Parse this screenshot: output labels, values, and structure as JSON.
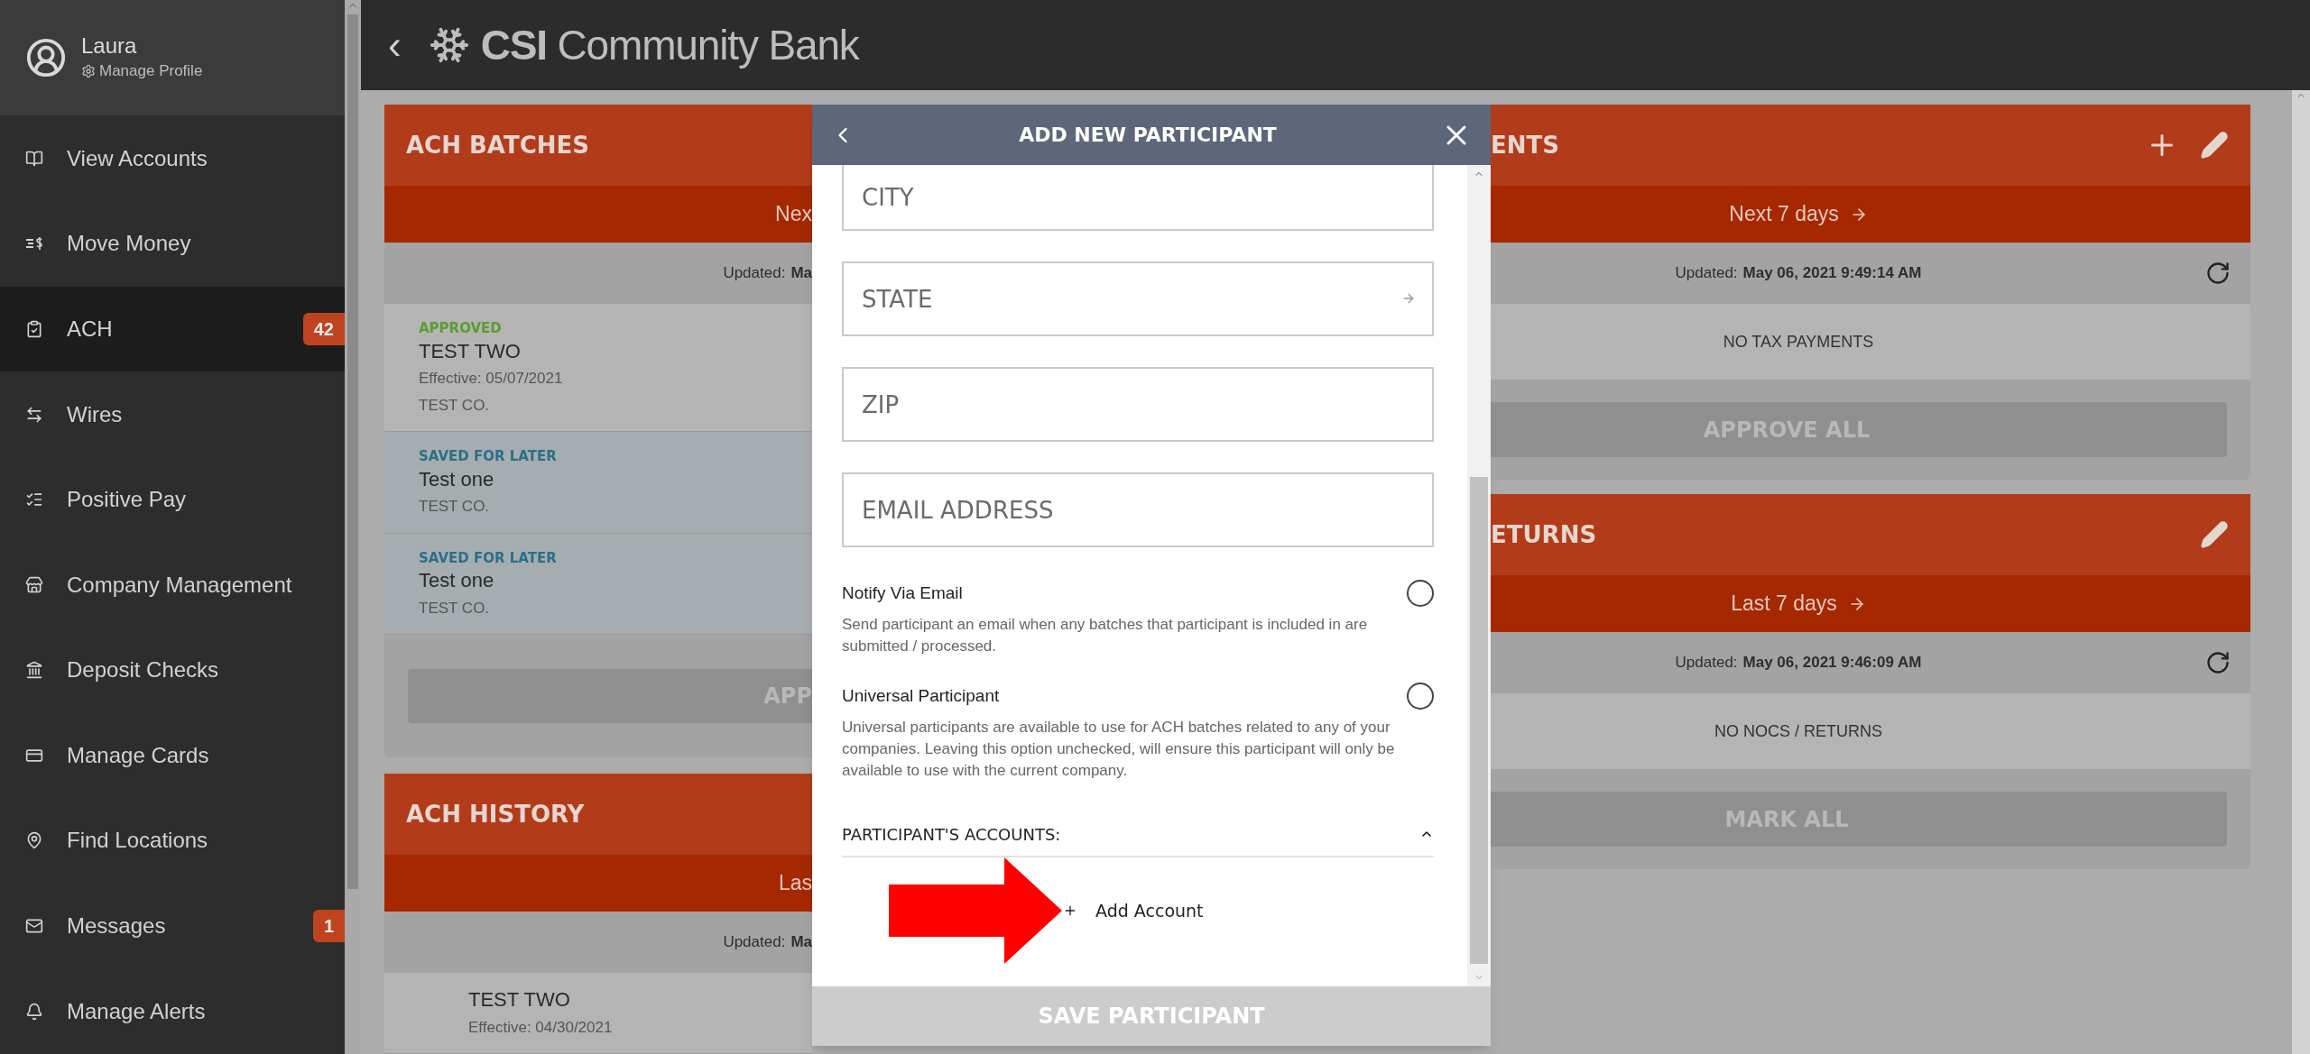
{
  "sidebar": {
    "user": {
      "name": "Laura",
      "link": "Manage Profile"
    },
    "items": [
      {
        "label": "View Accounts",
        "selected": false
      },
      {
        "label": "Move Money",
        "selected": false
      },
      {
        "label": "ACH",
        "selected": true,
        "badge": "42"
      },
      {
        "label": "Wires",
        "selected": false
      },
      {
        "label": "Positive Pay",
        "selected": false
      },
      {
        "label": "Company Management",
        "selected": false
      },
      {
        "label": "Deposit Checks",
        "selected": false
      },
      {
        "label": "Manage Cards",
        "selected": false
      },
      {
        "label": "Find Locations",
        "selected": false
      },
      {
        "label": "Messages",
        "selected": false,
        "badge": "1"
      },
      {
        "label": "Manage Alerts",
        "selected": false
      }
    ]
  },
  "header": {
    "back": "‹",
    "brand_bold": "CSI",
    "brand_rest": "Community Bank"
  },
  "left_panels": [
    {
      "title": "ACH BATCHES",
      "period": "Nex",
      "updated_label": "Updated:",
      "updated_value": "Ma",
      "items": [
        {
          "kind": "approved",
          "status": "APPROVED",
          "name": "TEST TWO",
          "effective": "Effective: 05/07/2021",
          "company": "TEST CO."
        },
        {
          "kind": "saved",
          "status": "SAVED FOR LATER",
          "name": "Test one",
          "company": "TEST CO."
        },
        {
          "kind": "saved",
          "status": "SAVED FOR LATER",
          "name": "Test one",
          "company": "TEST CO."
        }
      ],
      "button": "APP"
    },
    {
      "title": "ACH HISTORY",
      "period": "Las",
      "updated_label": "Updated:",
      "updated_value": "Ma",
      "items": [
        {
          "kind": "history",
          "name": "TEST TWO",
          "effective": "Effective: 04/30/2021"
        }
      ]
    }
  ],
  "right_panels": [
    {
      "title": "ENTS",
      "add": true,
      "period": "Next 7 days",
      "updated_label": "Updated:",
      "updated_value": "May 06, 2021 9:49:14 AM",
      "empty": "NO TAX PAYMENTS",
      "button": "APPROVE ALL"
    },
    {
      "title": "ETURNS",
      "add": false,
      "period": "Last 7 days",
      "updated_label": "Updated:",
      "updated_value": "May 06, 2021 9:46:09 AM",
      "empty": "NO NOCS / RETURNS",
      "button": "MARK ALL"
    }
  ],
  "modal": {
    "title": "ADD NEW PARTICIPANT",
    "fields": [
      {
        "kind": "text",
        "placeholder": "CITY"
      },
      {
        "kind": "select",
        "placeholder": "STATE"
      },
      {
        "kind": "text",
        "placeholder": "ZIP"
      },
      {
        "kind": "text",
        "placeholder": "EMAIL ADDRESS"
      }
    ],
    "options": [
      {
        "label": "Notify Via Email",
        "description": "Send participant an email when any batches that participant is included in are submitted / processed.",
        "checked": false
      },
      {
        "label": "Universal Participant",
        "description": "Universal participants are available to use for ACH batches related to any of your companies. Leaving this option unchecked, will ensure this participant will only be available to use with the current company.",
        "checked": false
      }
    ],
    "section": {
      "title": "PARTICIPANT'S ACCOUNTS:",
      "expanded": true
    },
    "add_account": "Add Account",
    "save": "SAVE PARTICIPANT"
  }
}
